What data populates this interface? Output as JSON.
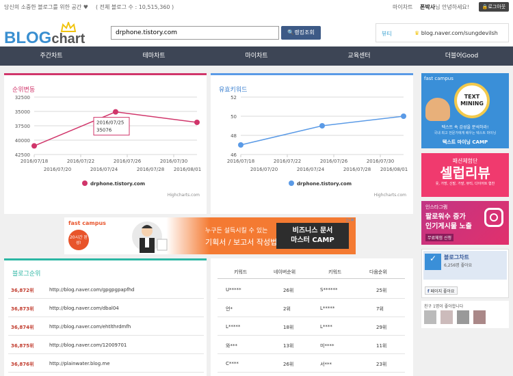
{
  "topbar": {
    "slogan": "당신의 소중한 블로그를 위한 공간 ♥",
    "blog_count": "( 전체 블로그 수 : 10,515,360 )",
    "mychart": "마이차트",
    "user": "폰박사",
    "greet_suffix": "님 안녕하세요!",
    "logout": "로그아웃"
  },
  "header": {
    "logo_a": "BLOG",
    "logo_b": "chart",
    "search_value": "drphone.tistory.com",
    "search_button": "랭킹조회",
    "featured_category": "뷰티",
    "featured_url": "blog.naver.com/sungdevilsh"
  },
  "nav": [
    "주간차트",
    "테마차트",
    "마이차트",
    "교육센터",
    "더블어Good"
  ],
  "rank_chart": {
    "title": "순위변동",
    "credit": "Highcharts.com",
    "legend": "drphone.tistory.com",
    "tooltip_date": "2016/07/25",
    "tooltip_value": "35076",
    "color": "#d0356a"
  },
  "keyword_chart": {
    "title": "유효키워드",
    "credit": "Highcharts.com",
    "legend": "drphone.tistory.com",
    "color": "#5a9ae6"
  },
  "chart_data": [
    {
      "type": "line",
      "title": "순위변동",
      "y_reversed": true,
      "yticks": [
        "32500",
        "35000",
        "37500",
        "40000",
        "42500"
      ],
      "xticks_top": [
        "2016/07/18",
        "2016/07/22",
        "2016/07/26",
        "2016/07/30"
      ],
      "xticks_bottom": [
        "2016/07/20",
        "2016/07/24",
        "2016/07/28",
        "2016/08/01"
      ],
      "x": [
        "2016/07/18",
        "2016/07/25",
        "2016/08/01"
      ],
      "series": [
        {
          "name": "drphone.tistory.com",
          "values": [
            41000,
            35076,
            36900
          ]
        }
      ],
      "ylim": [
        32500,
        42500
      ]
    },
    {
      "type": "line",
      "title": "유효키워드",
      "yticks": [
        "52",
        "50",
        "48",
        "46"
      ],
      "xticks_top": [
        "2016/07/18",
        "2016/07/22",
        "2016/07/26",
        "2016/07/30"
      ],
      "xticks_bottom": [
        "2016/07/20",
        "2016/07/24",
        "2016/07/28",
        "2016/08/01"
      ],
      "x": [
        "2016/07/18",
        "2016/07/25",
        "2016/08/01"
      ],
      "series": [
        {
          "name": "drphone.tistory.com",
          "values": [
            47,
            49,
            50
          ]
        }
      ],
      "ylim": [
        46,
        52
      ]
    }
  ],
  "banner": {
    "brand": "fast campus",
    "badge": "20시간 완성!",
    "line1": "누구든 설득시킬 수 있는",
    "line2": "기획서 / 보고서 작성법",
    "box1": "비즈니스 문서",
    "box2": "마스터 CAMP"
  },
  "side_ads": {
    "ad1_brand": "fast campus",
    "ad1_title1": "TEXT",
    "ad1_title2": "MINING",
    "ad1_sub": "텍스트 속 감성을 분석하라!",
    "ad1_desc": "국내 최고 전문가에게 배우는 텍스트 마이닝",
    "ad1_cta": "텍스트 마이닝 CAMP",
    "ad2_small": "패션체험단",
    "ad2_big": "셀럽리뷰",
    "ad2_sub": "옷, 가방, 신발, 가발, 뷰티, 다이어트 협찬",
    "ad3_a": "인스타그램",
    "ad3_b": "팔로워수 증가",
    "ad3_c": "인기게시물 노출",
    "ad3_cta": "무료체험 신청",
    "fb_name": "블로그차트",
    "fb_likes": "6,256명 좋아요",
    "fb_button": "페이지 좋아요",
    "friends": "친구 1명이 좋아합니다"
  },
  "blog_rank": {
    "title": "블로그순위",
    "rows": [
      {
        "rank": "36,872위",
        "url": "http://blog.naver.com/gpgpgpapfhd"
      },
      {
        "rank": "36,873위",
        "url": "http://blog.naver.com/dbal04"
      },
      {
        "rank": "36,874위",
        "url": "http://blog.naver.com/ehtlthrdmfh"
      },
      {
        "rank": "36,875위",
        "url": "http://blog.naver.com/12009701"
      },
      {
        "rank": "36,876위",
        "url": "http://plainwater.blog.me"
      }
    ]
  },
  "keyword_table": {
    "headers": [
      "키워드",
      "네이버순위",
      "키워드",
      "다음순위"
    ],
    "rows": [
      [
        "U*****",
        "26위",
        "S******",
        "25위"
      ],
      [
        "언*",
        "2위",
        "L*****",
        "7위"
      ],
      [
        "L*****",
        "18위",
        "L****",
        "29위"
      ],
      [
        "와***",
        "13위",
        "미****",
        "11위"
      ],
      [
        "C****",
        "26위",
        "서***",
        "23위"
      ]
    ]
  }
}
